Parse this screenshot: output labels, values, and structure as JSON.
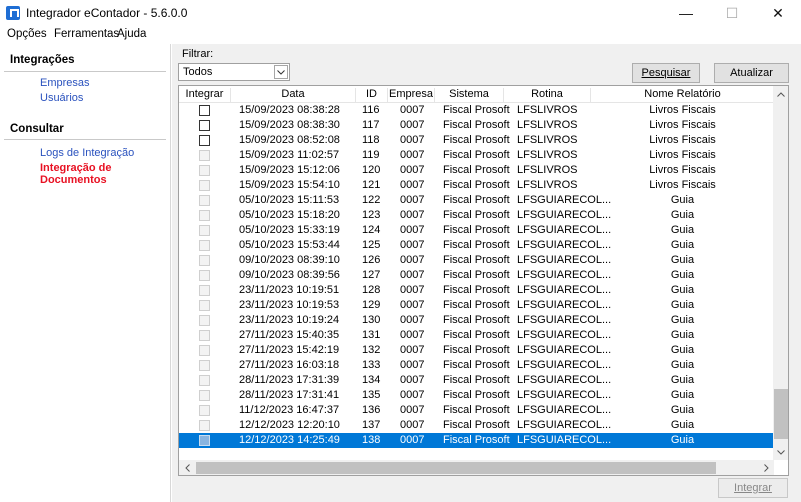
{
  "window": {
    "title": "Integrador eContador - 5.6.0.0",
    "min_glyph": "—",
    "max_glyph": "☐",
    "close_glyph": "✕"
  },
  "menu": [
    "Opções",
    "Ferramentas",
    "Ajuda"
  ],
  "sidebar": {
    "section1": "Integrações",
    "section1_items": [
      "Empresas",
      "Usuários"
    ],
    "section2": "Consultar",
    "section2_items": [
      "Logs de Integração",
      "Integração de Documentos"
    ],
    "active_item": "Integração de Documentos",
    "link_color": "#2a52be",
    "active_color": "#e81123"
  },
  "filter": {
    "label": "Filtrar:",
    "value": "Todos"
  },
  "buttons": {
    "search": "Pesquisar",
    "refresh": "Atualizar",
    "integrate": "Integrar"
  },
  "grid": {
    "columns": [
      "Integrar",
      "Data",
      "ID",
      "Empresa",
      "Sistema",
      "Rotina",
      "Nome Relatório"
    ],
    "selected_color": "#0078d7",
    "rows": [
      {
        "enabled": true,
        "data": "15/09/2023 08:38:28",
        "id": "116",
        "empresa": "0007",
        "sistema": "Fiscal Prosoft",
        "rotina": "LFSLIVROS",
        "nome": "Livros Fiscais"
      },
      {
        "enabled": true,
        "data": "15/09/2023 08:38:30",
        "id": "117",
        "empresa": "0007",
        "sistema": "Fiscal Prosoft",
        "rotina": "LFSLIVROS",
        "nome": "Livros Fiscais"
      },
      {
        "enabled": true,
        "data": "15/09/2023 08:52:08",
        "id": "118",
        "empresa": "0007",
        "sistema": "Fiscal Prosoft",
        "rotina": "LFSLIVROS",
        "nome": "Livros Fiscais"
      },
      {
        "enabled": false,
        "data": "15/09/2023 11:02:57",
        "id": "119",
        "empresa": "0007",
        "sistema": "Fiscal Prosoft",
        "rotina": "LFSLIVROS",
        "nome": "Livros Fiscais"
      },
      {
        "enabled": false,
        "data": "15/09/2023 15:12:06",
        "id": "120",
        "empresa": "0007",
        "sistema": "Fiscal Prosoft",
        "rotina": "LFSLIVROS",
        "nome": "Livros Fiscais"
      },
      {
        "enabled": false,
        "data": "15/09/2023 15:54:10",
        "id": "121",
        "empresa": "0007",
        "sistema": "Fiscal Prosoft",
        "rotina": "LFSLIVROS",
        "nome": "Livros Fiscais"
      },
      {
        "enabled": false,
        "data": "05/10/2023 15:11:53",
        "id": "122",
        "empresa": "0007",
        "sistema": "Fiscal Prosoft",
        "rotina": "LFSGUIARECOL...",
        "nome": "Guia"
      },
      {
        "enabled": false,
        "data": "05/10/2023 15:18:20",
        "id": "123",
        "empresa": "0007",
        "sistema": "Fiscal Prosoft",
        "rotina": "LFSGUIARECOL...",
        "nome": "Guia"
      },
      {
        "enabled": false,
        "data": "05/10/2023 15:33:19",
        "id": "124",
        "empresa": "0007",
        "sistema": "Fiscal Prosoft",
        "rotina": "LFSGUIARECOL...",
        "nome": "Guia"
      },
      {
        "enabled": false,
        "data": "05/10/2023 15:53:44",
        "id": "125",
        "empresa": "0007",
        "sistema": "Fiscal Prosoft",
        "rotina": "LFSGUIARECOL...",
        "nome": "Guia"
      },
      {
        "enabled": false,
        "data": "09/10/2023 08:39:10",
        "id": "126",
        "empresa": "0007",
        "sistema": "Fiscal Prosoft",
        "rotina": "LFSGUIARECOL...",
        "nome": "Guia"
      },
      {
        "enabled": false,
        "data": "09/10/2023 08:39:56",
        "id": "127",
        "empresa": "0007",
        "sistema": "Fiscal Prosoft",
        "rotina": "LFSGUIARECOL...",
        "nome": "Guia"
      },
      {
        "enabled": false,
        "data": "23/11/2023 10:19:51",
        "id": "128",
        "empresa": "0007",
        "sistema": "Fiscal Prosoft",
        "rotina": "LFSGUIARECOL...",
        "nome": "Guia"
      },
      {
        "enabled": false,
        "data": "23/11/2023 10:19:53",
        "id": "129",
        "empresa": "0007",
        "sistema": "Fiscal Prosoft",
        "rotina": "LFSGUIARECOL...",
        "nome": "Guia"
      },
      {
        "enabled": false,
        "data": "23/11/2023 10:19:24",
        "id": "130",
        "empresa": "0007",
        "sistema": "Fiscal Prosoft",
        "rotina": "LFSGUIARECOL...",
        "nome": "Guia"
      },
      {
        "enabled": false,
        "data": "27/11/2023 15:40:35",
        "id": "131",
        "empresa": "0007",
        "sistema": "Fiscal Prosoft",
        "rotina": "LFSGUIARECOL...",
        "nome": "Guia"
      },
      {
        "enabled": false,
        "data": "27/11/2023 15:42:19",
        "id": "132",
        "empresa": "0007",
        "sistema": "Fiscal Prosoft",
        "rotina": "LFSGUIARECOL...",
        "nome": "Guia"
      },
      {
        "enabled": false,
        "data": "27/11/2023 16:03:18",
        "id": "133",
        "empresa": "0007",
        "sistema": "Fiscal Prosoft",
        "rotina": "LFSGUIARECOL...",
        "nome": "Guia"
      },
      {
        "enabled": false,
        "data": "28/11/2023 17:31:39",
        "id": "134",
        "empresa": "0007",
        "sistema": "Fiscal Prosoft",
        "rotina": "LFSGUIARECOL...",
        "nome": "Guia"
      },
      {
        "enabled": false,
        "data": "28/11/2023 17:31:41",
        "id": "135",
        "empresa": "0007",
        "sistema": "Fiscal Prosoft",
        "rotina": "LFSGUIARECOL...",
        "nome": "Guia"
      },
      {
        "enabled": false,
        "data": "11/12/2023 16:47:37",
        "id": "136",
        "empresa": "0007",
        "sistema": "Fiscal Prosoft",
        "rotina": "LFSGUIARECOL...",
        "nome": "Guia"
      },
      {
        "enabled": false,
        "data": "12/12/2023 12:20:10",
        "id": "137",
        "empresa": "0007",
        "sistema": "Fiscal Prosoft",
        "rotina": "LFSGUIARECOL...",
        "nome": "Guia"
      },
      {
        "enabled": false,
        "selected": true,
        "data": "12/12/2023 14:25:49",
        "id": "138",
        "empresa": "0007",
        "sistema": "Fiscal Prosoft",
        "rotina": "LFSGUIARECOL...",
        "nome": "Guia"
      }
    ]
  }
}
